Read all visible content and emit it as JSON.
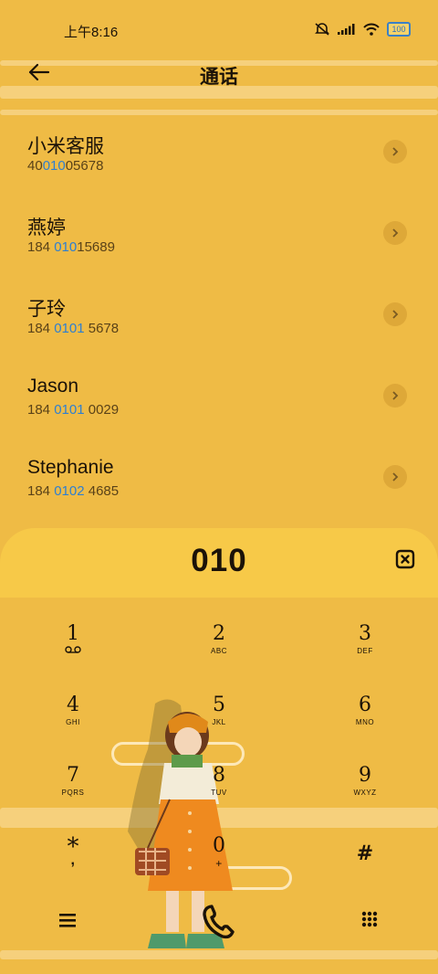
{
  "status_bar": {
    "time": "上午8:16",
    "battery": "100"
  },
  "header": {
    "title": "通话"
  },
  "contacts": [
    {
      "name": "小米客服",
      "num_pre": "40",
      "num_hl": "010",
      "num_post": "05678"
    },
    {
      "name": "燕婷",
      "num_pre": "184 ",
      "num_hl": "010",
      "num_post": "15689"
    },
    {
      "name": "子玲",
      "num_pre": "184 ",
      "num_hl": "0101",
      "num_post": " 5678"
    },
    {
      "name": "Jason",
      "num_pre": "184 ",
      "num_hl": "0101",
      "num_post": " 0029"
    },
    {
      "name": "Stephanie",
      "num_pre": "184 ",
      "num_hl": "0102",
      "num_post": " 4685"
    }
  ],
  "dialer": {
    "input": "010",
    "keys": [
      {
        "digit": "1",
        "letters": ""
      },
      {
        "digit": "2",
        "letters": "ABC"
      },
      {
        "digit": "3",
        "letters": "DEF"
      },
      {
        "digit": "4",
        "letters": "GHI"
      },
      {
        "digit": "5",
        "letters": "JKL"
      },
      {
        "digit": "6",
        "letters": "MNO"
      },
      {
        "digit": "7",
        "letters": "PQRS"
      },
      {
        "digit": "8",
        "letters": "TUV"
      },
      {
        "digit": "9",
        "letters": "WXYZ"
      },
      {
        "digit": "*",
        "letters": ","
      },
      {
        "digit": "0",
        "letters": "+"
      },
      {
        "digit": "#",
        "letters": ""
      }
    ]
  },
  "icons": {
    "back": "arrow-left-icon",
    "delete": "delete-icon",
    "voicemail": "voicemail-icon",
    "menu": "menu-icon",
    "call": "phone-icon",
    "keypad_toggle": "keypad-grid-icon"
  },
  "colors": {
    "background": "#efbb45",
    "panel": "#f7c948",
    "highlight": "#2e7fd0"
  }
}
